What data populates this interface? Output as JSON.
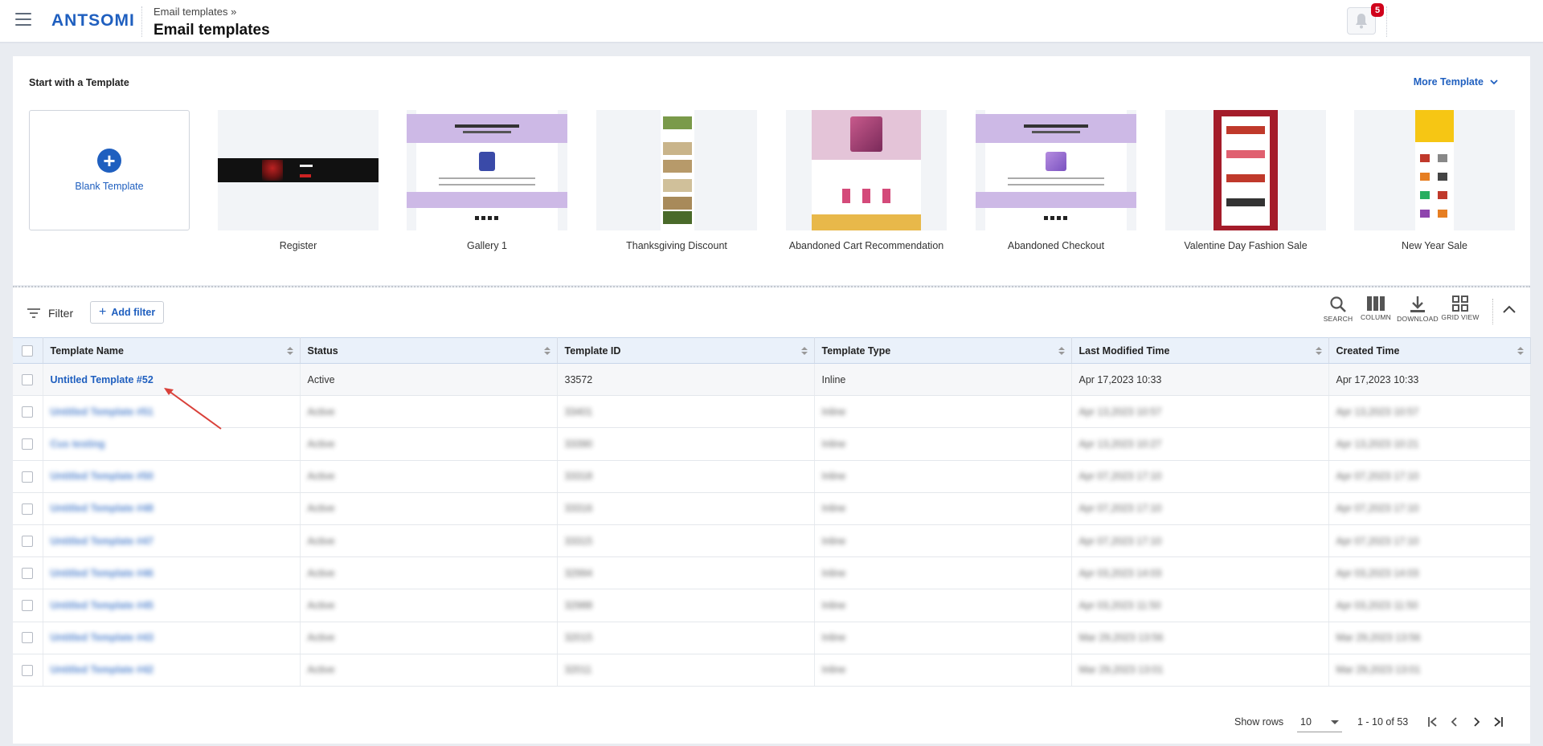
{
  "header": {
    "logo": "ANTSOMI",
    "breadcrumb": "Email templates »",
    "title": "Email templates",
    "notification_count": "5"
  },
  "templates": {
    "section_title": "Start with a Template",
    "more_label": "More Template",
    "blank_label": "Blank Template",
    "items": [
      {
        "name": "Register"
      },
      {
        "name": "Gallery 1"
      },
      {
        "name": "Thanksgiving Discount"
      },
      {
        "name": "Abandoned Cart Recommendation"
      },
      {
        "name": "Abandoned Checkout"
      },
      {
        "name": "Valentine Day Fashion Sale"
      },
      {
        "name": "New Year Sale"
      }
    ]
  },
  "toolbar": {
    "filter_label": "Filter",
    "add_filter_label": "Add filter",
    "search_label": "SEARCH",
    "column_label": "COLUMN",
    "download_label": "DOWNLOAD",
    "grid_view_label": "GRID VIEW"
  },
  "table": {
    "columns": [
      "Template Name",
      "Status",
      "Template ID",
      "Template Type",
      "Last Modified Time",
      "Created Time"
    ],
    "rows": [
      {
        "name": "Untitled Template #52",
        "status": "Active",
        "id": "33572",
        "type": "Inline",
        "modified": "Apr 17,2023 10:33",
        "created": "Apr 17,2023 10:33"
      },
      {
        "name": "Untitled Template #51",
        "status": "Active",
        "id": "33401",
        "type": "Inline",
        "modified": "Apr 13,2023 10:57",
        "created": "Apr 13,2023 10:57"
      },
      {
        "name": "Cus testing",
        "status": "Active",
        "id": "33390",
        "type": "Inline",
        "modified": "Apr 13,2023 10:27",
        "created": "Apr 13,2023 10:21"
      },
      {
        "name": "Untitled Template #50",
        "status": "Active",
        "id": "33318",
        "type": "Inline",
        "modified": "Apr 07,2023 17:10",
        "created": "Apr 07,2023 17:10"
      },
      {
        "name": "Untitled Template #48",
        "status": "Active",
        "id": "33316",
        "type": "Inline",
        "modified": "Apr 07,2023 17:10",
        "created": "Apr 07,2023 17:10"
      },
      {
        "name": "Untitled Template #47",
        "status": "Active",
        "id": "33315",
        "type": "Inline",
        "modified": "Apr 07,2023 17:10",
        "created": "Apr 07,2023 17:10"
      },
      {
        "name": "Untitled Template #46",
        "status": "Active",
        "id": "32994",
        "type": "Inline",
        "modified": "Apr 03,2023 14:03",
        "created": "Apr 03,2023 14:03"
      },
      {
        "name": "Untitled Template #45",
        "status": "Active",
        "id": "32988",
        "type": "Inline",
        "modified": "Apr 03,2023 11:50",
        "created": "Apr 03,2023 11:50"
      },
      {
        "name": "Untitled Template #43",
        "status": "Active",
        "id": "32015",
        "type": "Inline",
        "modified": "Mar 29,2023 13:56",
        "created": "Mar 29,2023 13:56"
      },
      {
        "name": "Untitled Template #42",
        "status": "Active",
        "id": "32011",
        "type": "Inline",
        "modified": "Mar 29,2023 13:01",
        "created": "Mar 29,2023 13:01"
      }
    ]
  },
  "pagination": {
    "show_rows_label": "Show rows",
    "rows_per_page": "10",
    "range_text": "1 - 10 of 53"
  },
  "colors": {
    "brand": "#1f5fbf",
    "badge": "#d0021b",
    "annotation_arrow": "#d9413a"
  }
}
